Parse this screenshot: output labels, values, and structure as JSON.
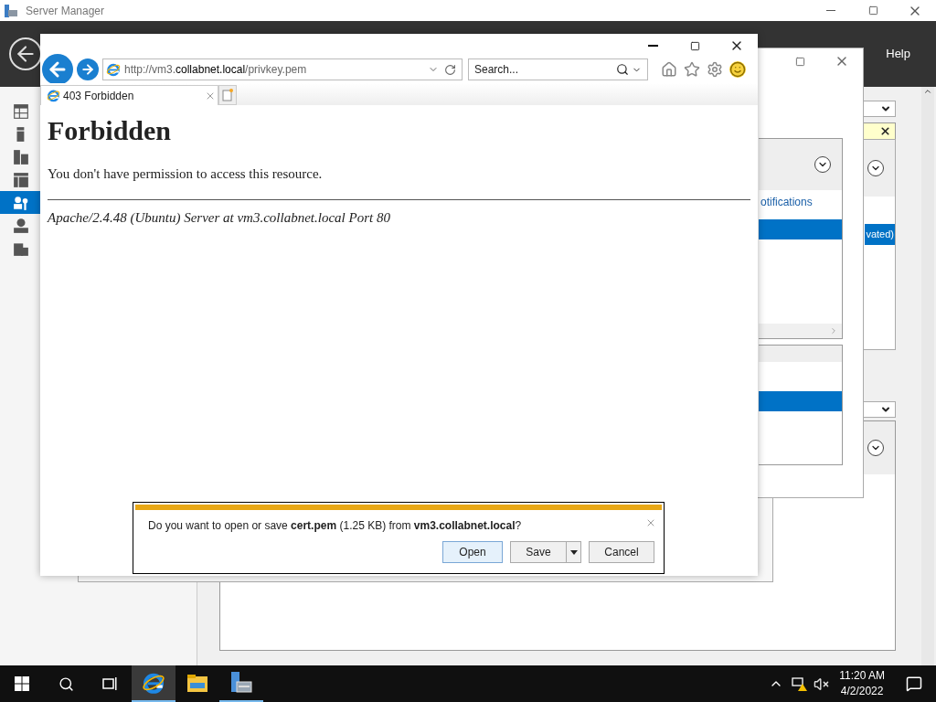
{
  "server_manager": {
    "title": "Server Manager",
    "menu": [
      "Help"
    ],
    "sidebar_items": [
      {
        "selected": false
      },
      {
        "selected": false
      },
      {
        "selected": false
      },
      {
        "selected": false
      },
      {
        "selected": true
      },
      {
        "selected": false
      },
      {
        "selected": false
      }
    ],
    "right_panel_row": "vated)"
  },
  "background_window": {
    "link": "otifications"
  },
  "browser": {
    "address": "http://vm3.**collabnet.local**/privkey.pem",
    "search": {
      "placeholder": "Search..."
    },
    "tabs": [
      {
        "label": "403 Forbidden",
        "selected": true
      }
    ],
    "page": {
      "heading": "Forbidden",
      "message": "You don't have permission to access this resource.",
      "footer": "Apache/2.4.48 (Ubuntu) Server at vm3.collabnet.local Port 80"
    }
  },
  "download_bar": {
    "message": "Do you want to open or save **cert.pem** (1.25 KB) from **vm3.collabnet.local**?",
    "buttons": [
      {
        "label": "Open",
        "kind": "primary"
      },
      {
        "label": "Save",
        "kind": "split"
      },
      {
        "label": "Cancel",
        "kind": "plain"
      }
    ]
  },
  "taskbar": {
    "apps": [
      {
        "kind": "browser",
        "selected": true,
        "running": true
      },
      {
        "kind": "folder",
        "selected": false,
        "running": false
      },
      {
        "kind": "server",
        "selected": false,
        "running": true
      }
    ],
    "time": "11:20 AM",
    "date": "4/2/2022"
  }
}
